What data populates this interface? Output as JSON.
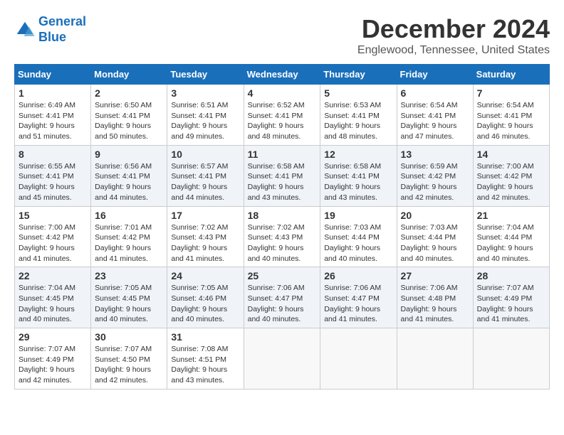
{
  "header": {
    "logo_line1": "General",
    "logo_line2": "Blue",
    "month_title": "December 2024",
    "location": "Englewood, Tennessee, United States"
  },
  "weekdays": [
    "Sunday",
    "Monday",
    "Tuesday",
    "Wednesday",
    "Thursday",
    "Friday",
    "Saturday"
  ],
  "weeks": [
    [
      {
        "day": "1",
        "sunrise": "6:49 AM",
        "sunset": "4:41 PM",
        "daylight": "9 hours and 51 minutes."
      },
      {
        "day": "2",
        "sunrise": "6:50 AM",
        "sunset": "4:41 PM",
        "daylight": "9 hours and 50 minutes."
      },
      {
        "day": "3",
        "sunrise": "6:51 AM",
        "sunset": "4:41 PM",
        "daylight": "9 hours and 49 minutes."
      },
      {
        "day": "4",
        "sunrise": "6:52 AM",
        "sunset": "4:41 PM",
        "daylight": "9 hours and 48 minutes."
      },
      {
        "day": "5",
        "sunrise": "6:53 AM",
        "sunset": "4:41 PM",
        "daylight": "9 hours and 48 minutes."
      },
      {
        "day": "6",
        "sunrise": "6:54 AM",
        "sunset": "4:41 PM",
        "daylight": "9 hours and 47 minutes."
      },
      {
        "day": "7",
        "sunrise": "6:54 AM",
        "sunset": "4:41 PM",
        "daylight": "9 hours and 46 minutes."
      }
    ],
    [
      {
        "day": "8",
        "sunrise": "6:55 AM",
        "sunset": "4:41 PM",
        "daylight": "9 hours and 45 minutes."
      },
      {
        "day": "9",
        "sunrise": "6:56 AM",
        "sunset": "4:41 PM",
        "daylight": "9 hours and 44 minutes."
      },
      {
        "day": "10",
        "sunrise": "6:57 AM",
        "sunset": "4:41 PM",
        "daylight": "9 hours and 44 minutes."
      },
      {
        "day": "11",
        "sunrise": "6:58 AM",
        "sunset": "4:41 PM",
        "daylight": "9 hours and 43 minutes."
      },
      {
        "day": "12",
        "sunrise": "6:58 AM",
        "sunset": "4:41 PM",
        "daylight": "9 hours and 43 minutes."
      },
      {
        "day": "13",
        "sunrise": "6:59 AM",
        "sunset": "4:42 PM",
        "daylight": "9 hours and 42 minutes."
      },
      {
        "day": "14",
        "sunrise": "7:00 AM",
        "sunset": "4:42 PM",
        "daylight": "9 hours and 42 minutes."
      }
    ],
    [
      {
        "day": "15",
        "sunrise": "7:00 AM",
        "sunset": "4:42 PM",
        "daylight": "9 hours and 41 minutes."
      },
      {
        "day": "16",
        "sunrise": "7:01 AM",
        "sunset": "4:42 PM",
        "daylight": "9 hours and 41 minutes."
      },
      {
        "day": "17",
        "sunrise": "7:02 AM",
        "sunset": "4:43 PM",
        "daylight": "9 hours and 41 minutes."
      },
      {
        "day": "18",
        "sunrise": "7:02 AM",
        "sunset": "4:43 PM",
        "daylight": "9 hours and 40 minutes."
      },
      {
        "day": "19",
        "sunrise": "7:03 AM",
        "sunset": "4:44 PM",
        "daylight": "9 hours and 40 minutes."
      },
      {
        "day": "20",
        "sunrise": "7:03 AM",
        "sunset": "4:44 PM",
        "daylight": "9 hours and 40 minutes."
      },
      {
        "day": "21",
        "sunrise": "7:04 AM",
        "sunset": "4:44 PM",
        "daylight": "9 hours and 40 minutes."
      }
    ],
    [
      {
        "day": "22",
        "sunrise": "7:04 AM",
        "sunset": "4:45 PM",
        "daylight": "9 hours and 40 minutes."
      },
      {
        "day": "23",
        "sunrise": "7:05 AM",
        "sunset": "4:45 PM",
        "daylight": "9 hours and 40 minutes."
      },
      {
        "day": "24",
        "sunrise": "7:05 AM",
        "sunset": "4:46 PM",
        "daylight": "9 hours and 40 minutes."
      },
      {
        "day": "25",
        "sunrise": "7:06 AM",
        "sunset": "4:47 PM",
        "daylight": "9 hours and 40 minutes."
      },
      {
        "day": "26",
        "sunrise": "7:06 AM",
        "sunset": "4:47 PM",
        "daylight": "9 hours and 41 minutes."
      },
      {
        "day": "27",
        "sunrise": "7:06 AM",
        "sunset": "4:48 PM",
        "daylight": "9 hours and 41 minutes."
      },
      {
        "day": "28",
        "sunrise": "7:07 AM",
        "sunset": "4:49 PM",
        "daylight": "9 hours and 41 minutes."
      }
    ],
    [
      {
        "day": "29",
        "sunrise": "7:07 AM",
        "sunset": "4:49 PM",
        "daylight": "9 hours and 42 minutes."
      },
      {
        "day": "30",
        "sunrise": "7:07 AM",
        "sunset": "4:50 PM",
        "daylight": "9 hours and 42 minutes."
      },
      {
        "day": "31",
        "sunrise": "7:08 AM",
        "sunset": "4:51 PM",
        "daylight": "9 hours and 43 minutes."
      },
      null,
      null,
      null,
      null
    ]
  ]
}
